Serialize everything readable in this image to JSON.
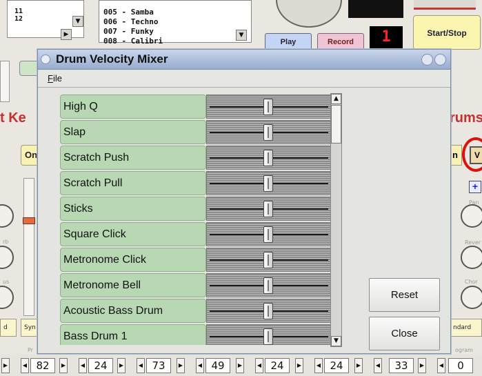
{
  "background": {
    "list_left_items": [
      "11",
      "12"
    ],
    "pattern_list": [
      "005 - Samba",
      "006 - Techno",
      "007 - Funky",
      "008 - Calibri"
    ],
    "play_label": "Play",
    "record_label": "Record",
    "counter_value": "1",
    "start_stop_label": "Start/Stop",
    "header_left_partial": "t Ke",
    "header_right_partial": "rums",
    "on_label": "On",
    "n_label": "n",
    "v_label": "V",
    "plus_label": "+",
    "side_labels": [
      "Pan",
      "Rever",
      "Chor",
      "rb",
      "us"
    ],
    "bottom_selects": [
      "d",
      "Syn",
      "ndard"
    ],
    "faded_labels": [
      "Pr",
      "ogram"
    ],
    "spin_values": [
      "82",
      "24",
      "73",
      "49",
      "24",
      "24",
      "33",
      "0"
    ],
    "highlight_color": "#e01010"
  },
  "dialog": {
    "title": "Drum Velocity Mixer",
    "menu": {
      "file_mnemonic": "F",
      "file_rest": "ile"
    },
    "instruments": [
      {
        "name": "High Q",
        "velocity": 0.5
      },
      {
        "name": "Slap",
        "velocity": 0.5
      },
      {
        "name": "Scratch Push",
        "velocity": 0.5
      },
      {
        "name": "Scratch Pull",
        "velocity": 0.5
      },
      {
        "name": "Sticks",
        "velocity": 0.5
      },
      {
        "name": "Square Click",
        "velocity": 0.5
      },
      {
        "name": "Metronome Click",
        "velocity": 0.5
      },
      {
        "name": "Metronome Bell",
        "velocity": 0.5
      },
      {
        "name": "Acoustic Bass Drum",
        "velocity": 0.5
      },
      {
        "name": "Bass Drum 1",
        "velocity": 0.5
      }
    ],
    "reset_label": "Reset",
    "close_label": "Close",
    "label_color": "#b8d8b4"
  }
}
